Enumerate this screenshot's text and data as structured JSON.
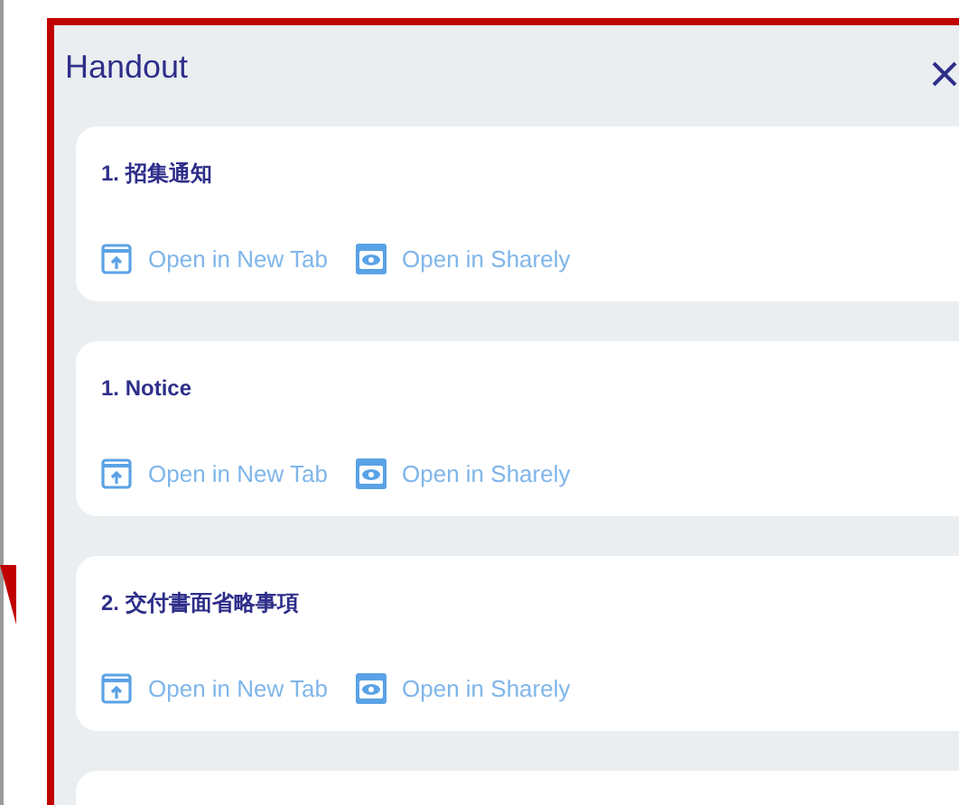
{
  "dialog": {
    "title": "Handout"
  },
  "items": [
    {
      "title": "1. 招集通知",
      "actions": [
        {
          "kind": "new-tab",
          "label": "Open in New Tab"
        },
        {
          "kind": "viewer",
          "label": "Open in Sharely"
        }
      ]
    },
    {
      "title": "1. Notice",
      "actions": [
        {
          "kind": "new-tab",
          "label": "Open in New Tab"
        },
        {
          "kind": "viewer",
          "label": "Open in Sharely"
        }
      ]
    },
    {
      "title": "2. 交付書面省略事項",
      "actions": [
        {
          "kind": "new-tab",
          "label": "Open in New Tab"
        },
        {
          "kind": "viewer",
          "label": "Open in Sharely"
        }
      ]
    }
  ]
}
